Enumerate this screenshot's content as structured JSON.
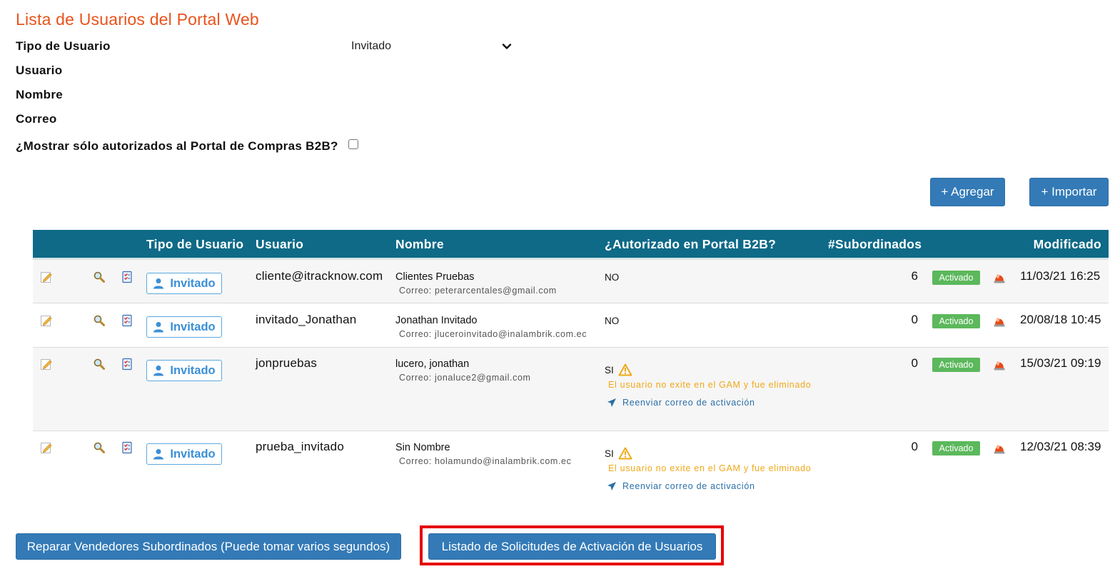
{
  "page": {
    "title": "Lista de Usuarios del Portal Web"
  },
  "filters": {
    "user_type_label": "Tipo de Usuario",
    "user_type_value": "Invitado",
    "user_label": "Usuario",
    "name_label": "Nombre",
    "email_label": "Correo",
    "authorized_only_label": "¿Mostrar sólo autorizados al Portal de Compras B2B?",
    "authorized_only_checked": false
  },
  "actions": {
    "add_label": "+ Agregar",
    "import_label": "+ Importar"
  },
  "table": {
    "headers": {
      "user_type": "Tipo de Usuario",
      "user": "Usuario",
      "name": "Nombre",
      "authorized": "¿Autorizado en Portal B2B?",
      "subordinates": "#Subordinados",
      "modified": "Modificado"
    },
    "rows": [
      {
        "role": "Invitado",
        "user": "cliente@itracknow.com",
        "name": "Clientes Pruebas",
        "email": "Correo: peterarcentales@gmail.com",
        "authorized": "NO",
        "warning": "",
        "resend": "",
        "subordinates": "6",
        "status": "Activado",
        "modified": "11/03/21 16:25"
      },
      {
        "role": "Invitado",
        "user": "invitado_Jonathan",
        "name": "Jonathan Invitado",
        "email": "Correo: jluceroinvitado@inalambrik.com.ec",
        "authorized": "NO",
        "warning": "",
        "resend": "",
        "subordinates": "0",
        "status": "Activado",
        "modified": "20/08/18 10:45"
      },
      {
        "role": "Invitado",
        "user": "jonpruebas",
        "name": "lucero, jonathan",
        "email": "Correo: jonaluce2@gmail.com",
        "authorized": "SI",
        "warning": "El usuario no exite en el GAM y fue eliminado",
        "resend": "Reenviar correo de activación",
        "subordinates": "0",
        "status": "Activado",
        "modified": "15/03/21 09:19"
      },
      {
        "role": "Invitado",
        "user": "prueba_invitado",
        "name": "Sin Nombre",
        "email": "Correo: holamundo@inalambrik.com.ec",
        "authorized": "SI",
        "warning": "El usuario no exite en el GAM y fue eliminado",
        "resend": "Reenviar correo de activación",
        "subordinates": "0",
        "status": "Activado",
        "modified": "12/03/21 08:39"
      }
    ]
  },
  "footer": {
    "repair_label": "Reparar Vendedores Subordinados (Puede tomar varios segundos)",
    "activation_requests_label": "Listado de Solicitudes de Activación de Usuarios"
  },
  "colors": {
    "title": "#e8531c",
    "header_bg": "#0e6a87",
    "primary_button": "#337ab7",
    "status_badge": "#5cb85c",
    "warning_text": "#f0a818",
    "highlight_border": "#e60000"
  }
}
